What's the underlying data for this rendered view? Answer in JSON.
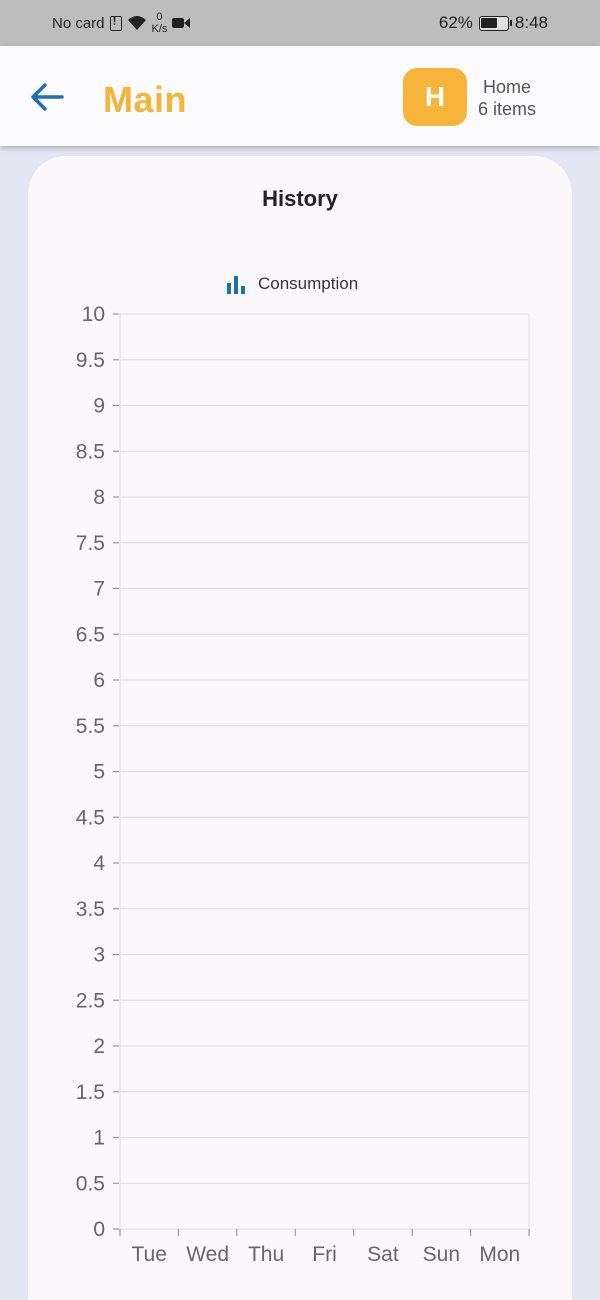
{
  "status_bar": {
    "carrier": "No card",
    "net_speed_value": "0",
    "net_speed_unit": "K/s",
    "battery": "62%",
    "time": "8:48"
  },
  "app_bar": {
    "title": "Main",
    "avatar_letter": "H",
    "home_name": "Home",
    "home_items": "6 items"
  },
  "colors": {
    "accent": "#f6b43b",
    "back_arrow": "#1e6fb0",
    "legend_icon": "#1e6fb0",
    "background": "#e6e5f3"
  },
  "chart_data": {
    "type": "bar",
    "title": "History",
    "legend": [
      "Consumption"
    ],
    "categories": [
      "Tue",
      "Wed",
      "Thu",
      "Fri",
      "Sat",
      "Sun",
      "Mon"
    ],
    "series": [
      {
        "name": "Consumption",
        "values": [
          0,
          0,
          0,
          0,
          0,
          0,
          0
        ]
      }
    ],
    "ylim": [
      0,
      10
    ],
    "yticks": [
      "0",
      "0.5",
      "1",
      "1.5",
      "2",
      "2.5",
      "3",
      "3.5",
      "4",
      "4.5",
      "5",
      "5.5",
      "6",
      "6.5",
      "7",
      "7.5",
      "8",
      "8.5",
      "9",
      "9.5",
      "10"
    ],
    "grid": true,
    "legend_position": "top"
  }
}
